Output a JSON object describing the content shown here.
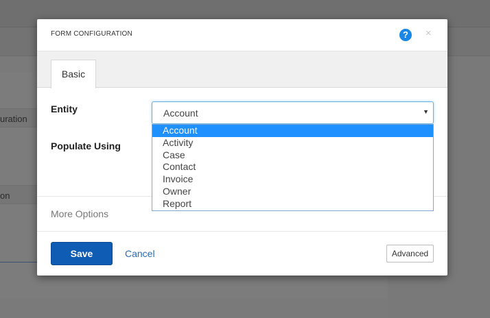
{
  "background": {
    "row_text_1": "uration",
    "row_text_2": "on"
  },
  "modal": {
    "title": "FORM CONFIGURATION",
    "help_glyph": "?",
    "close_glyph": "×",
    "tabs": [
      {
        "label": "Basic"
      }
    ],
    "fields": {
      "entity_label": "Entity",
      "populate_label": "Populate Using",
      "entity_value": "Account"
    },
    "dropdown": {
      "options": [
        "Account",
        "Activity",
        "Case",
        "Contact",
        "Invoice",
        "Owner",
        "Report"
      ],
      "selected_index": 0
    },
    "more_options_label": "More Options",
    "footer": {
      "save_label": "Save",
      "cancel_label": "Cancel",
      "advanced_label": "Advanced"
    }
  },
  "colors": {
    "primary_button": "#0f5cb5",
    "help_icon": "#1a86e6",
    "selected_option": "#1e90ff",
    "link": "#2a6db8"
  },
  "icons": {
    "help": "help-icon",
    "close": "close-icon",
    "caret": "chevron-down-icon"
  }
}
